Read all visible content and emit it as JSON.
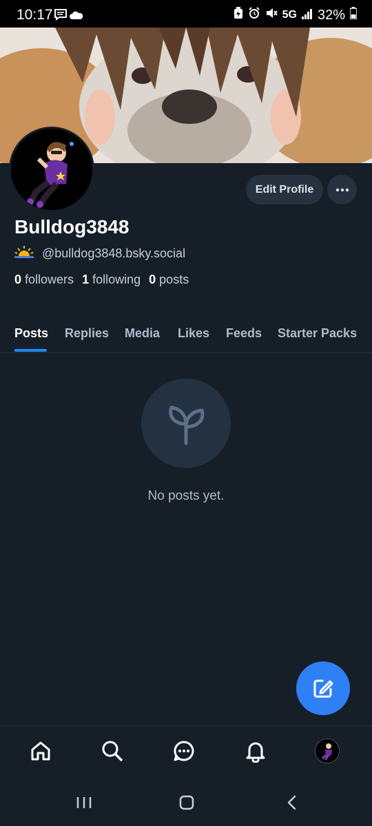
{
  "status_bar": {
    "time": "10:17",
    "network": "5G",
    "battery": "32%"
  },
  "profile": {
    "display_name": "Bulldog3848",
    "handle": "@bulldog3848.bsky.social",
    "followers_count": "0",
    "followers_label": "followers",
    "following_count": "1",
    "following_label": "following",
    "posts_count": "0",
    "posts_label": "posts",
    "edit_label": "Edit Profile"
  },
  "tabs": [
    {
      "label": "Posts",
      "active": true
    },
    {
      "label": "Replies"
    },
    {
      "label": "Media"
    },
    {
      "label": "Likes"
    },
    {
      "label": "Feeds"
    },
    {
      "label": "Starter Packs"
    }
  ],
  "empty_state": {
    "icon": "sprout-icon",
    "text": "No posts yet."
  },
  "fab": {
    "icon": "compose-icon"
  },
  "bottom_nav": [
    {
      "icon": "home-icon"
    },
    {
      "icon": "search-icon"
    },
    {
      "icon": "chat-icon"
    },
    {
      "icon": "bell-icon"
    },
    {
      "icon": "profile-avatar"
    }
  ],
  "colors": {
    "background": "#161e27",
    "accent": "#1e8cf5",
    "fab": "#2f80f5",
    "button": "#26323f"
  }
}
